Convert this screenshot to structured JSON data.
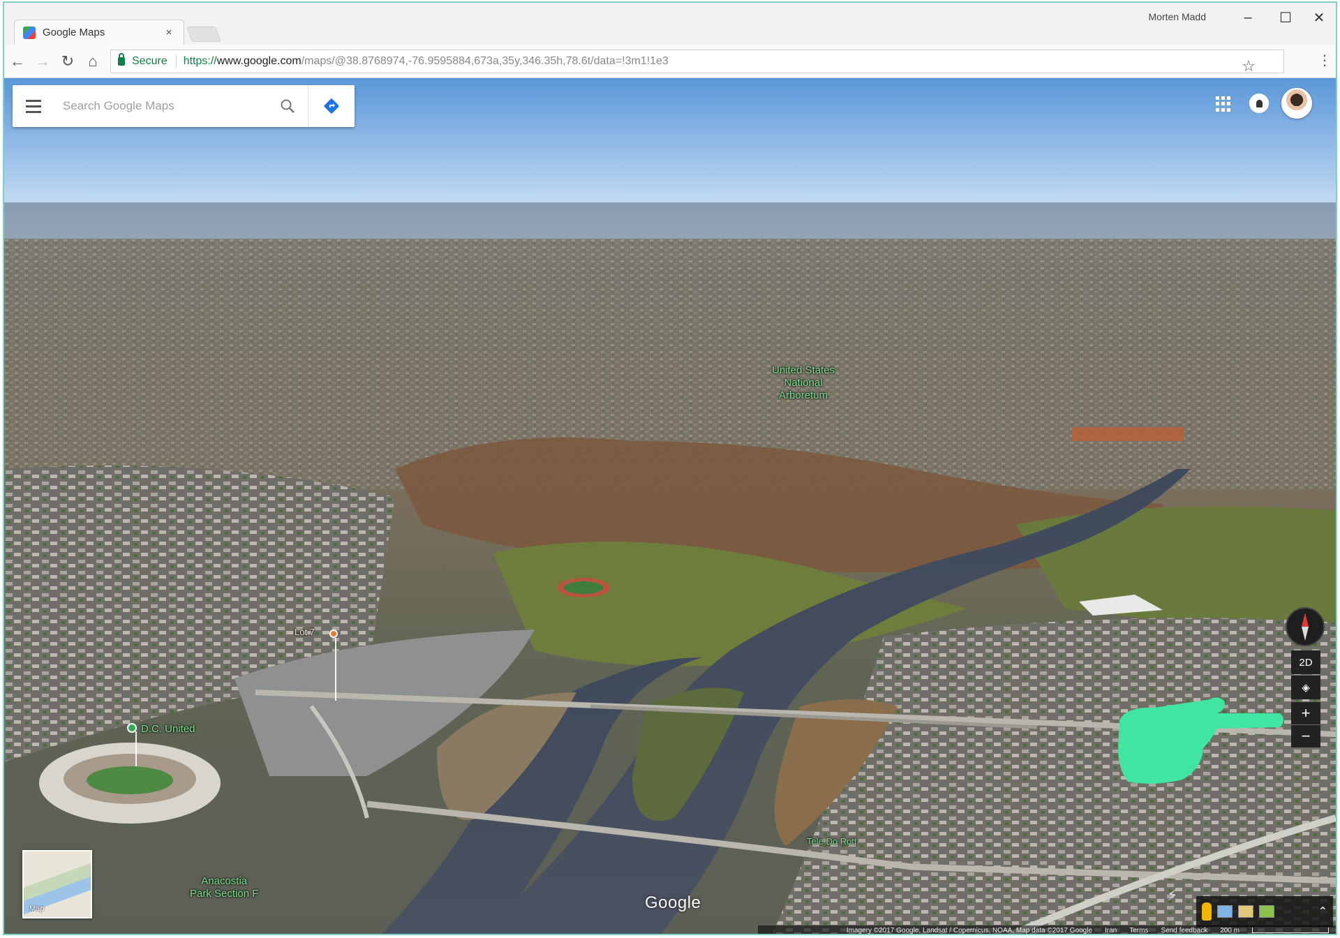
{
  "browser": {
    "tab_title": "Google Maps",
    "tab_close": "×",
    "profile_name": "Morten Madd",
    "window_controls": {
      "minimize": "–",
      "maximize": "☐",
      "close": "✕"
    },
    "nav": {
      "back": "←",
      "forward": "→",
      "reload": "↻",
      "home": "⌂"
    },
    "secure_label": "Secure",
    "url_scheme": "https://",
    "url_host": "www.google.com",
    "url_path": "/maps/@38.8768974,-76.9595884,673a,35y,346.35h,78.6t/data=!3m1!1e3",
    "star": "☆",
    "menu": "⋮"
  },
  "maps": {
    "search_placeholder": "Search Google Maps",
    "labels": {
      "arboretum": [
        "United States",
        "National",
        "Arboretum"
      ],
      "dc_united": "D.C. United",
      "lot_label": "Lot 7",
      "anacostia": [
        "Anacostia",
        "Park Section F"
      ],
      "tire_shop": "Tele Do Rott"
    },
    "watermark": "Google",
    "minimap_label": "Map",
    "controls": {
      "toggle_2d": "2D",
      "locate": "◈",
      "zoom_in": "+",
      "zoom_out": "−",
      "expand": "⌃"
    },
    "attribution": {
      "imagery": "Imagery ©2017 Google, Landsat / Copernicus, NOAA, Map data ©2017 Google",
      "country": "Iran",
      "terms": "Terms",
      "feedback": "Send feedback",
      "scale": "200 m"
    }
  },
  "colors": {
    "accent_green": "#0b8043",
    "pointer_hand": "#3fe5a0",
    "place_label": "#7fe08f",
    "directions_blue": "#1a73e8"
  }
}
